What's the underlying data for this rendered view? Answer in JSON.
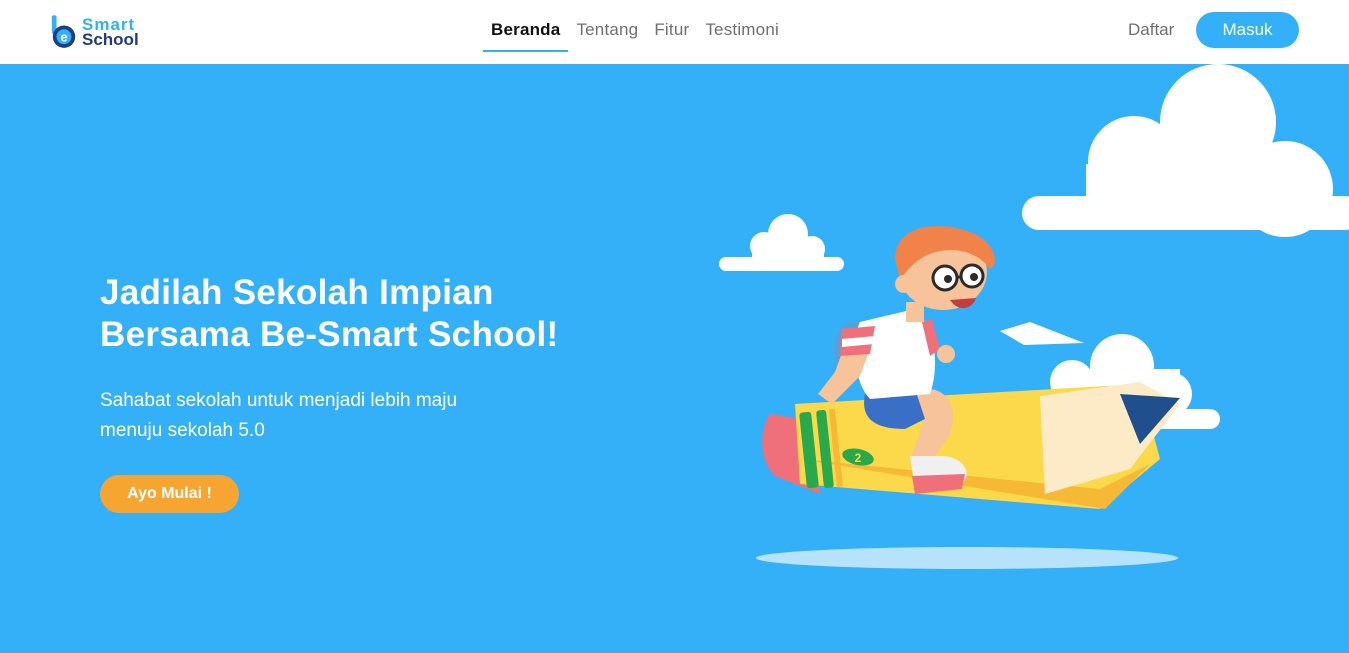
{
  "brand": {
    "logo_letter": "e",
    "name_line1": "Smart",
    "name_line2": "School"
  },
  "nav": {
    "items": [
      {
        "label": "Beranda",
        "active": true
      },
      {
        "label": "Tentang",
        "active": false
      },
      {
        "label": "Fitur",
        "active": false
      },
      {
        "label": "Testimoni",
        "active": false
      }
    ],
    "register_label": "Daftar",
    "login_label": "Masuk"
  },
  "hero": {
    "title_line1": "Jadilah Sekolah Impian",
    "title_line2": "Bersama Be-Smart School!",
    "subtitle_line1": "Sahabat sekolah untuk menjadi lebih maju",
    "subtitle_line2": "menuju sekolah 5.0",
    "cta_label": "Ayo Mulai !",
    "pencil_number": "2"
  },
  "colors": {
    "primary": "#33b0f8",
    "accent": "#f7a531",
    "brand_dark": "#1e3c8a",
    "text_muted": "#6f6f6f"
  },
  "icons": {
    "logo": "be-logo-icon",
    "illustration": "boy-riding-pencil-illustration"
  }
}
